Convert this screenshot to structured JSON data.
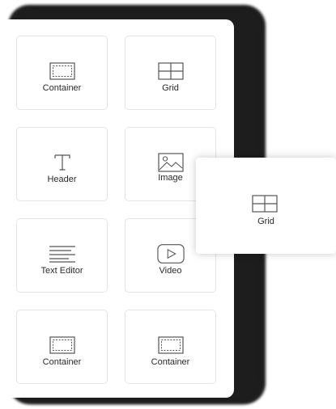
{
  "widgets": [
    {
      "label": "Container",
      "icon": "container-icon"
    },
    {
      "label": "Grid",
      "icon": "grid-icon"
    },
    {
      "label": "Header",
      "icon": "header-icon"
    },
    {
      "label": "Image",
      "icon": "image-icon"
    },
    {
      "label": "Text Editor",
      "icon": "text-editor-icon"
    },
    {
      "label": "Video",
      "icon": "video-icon"
    },
    {
      "label": "Container",
      "icon": "container-icon"
    },
    {
      "label": "Container",
      "icon": "container-icon"
    }
  ],
  "dragging": {
    "label": "Grid",
    "icon": "grid-icon"
  },
  "colors": {
    "icon_stroke": "#555555",
    "card_border": "#e4e4e4",
    "backdrop": "#1d1d1d"
  }
}
